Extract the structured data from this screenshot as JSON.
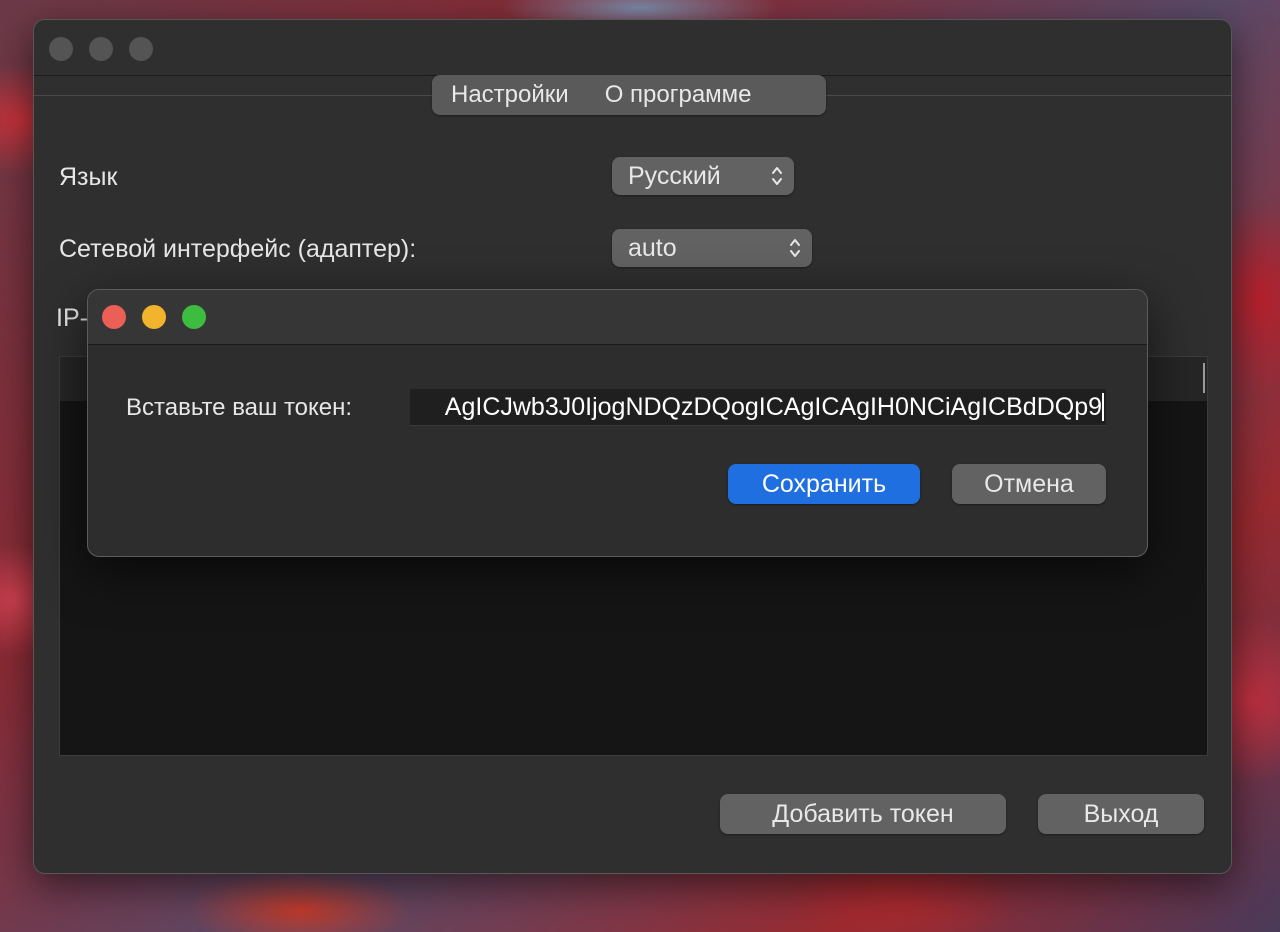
{
  "main_window": {
    "tabs": [
      "Настройки",
      "О программе"
    ],
    "language": {
      "label": "Язык",
      "value": "Русский"
    },
    "network_interface": {
      "label": "Сетевой интерфейс (адаптер):",
      "value": "auto"
    },
    "ip_label_partial": "IP-",
    "buttons": {
      "add_token": "Добавить токен",
      "exit": "Выход"
    }
  },
  "dialog": {
    "prompt": "Вставьте ваш токен:",
    "token_value": "AgICJwb3J0IjogNDQzDQogICAgICAgIH0NCiAgICBdDQp9",
    "buttons": {
      "save": "Сохранить",
      "cancel": "Отмена"
    }
  },
  "colors": {
    "accent": "#1f6fe0",
    "close": "#ec5f57",
    "minimize": "#f2b42c",
    "zoom": "#3dbd3f"
  }
}
